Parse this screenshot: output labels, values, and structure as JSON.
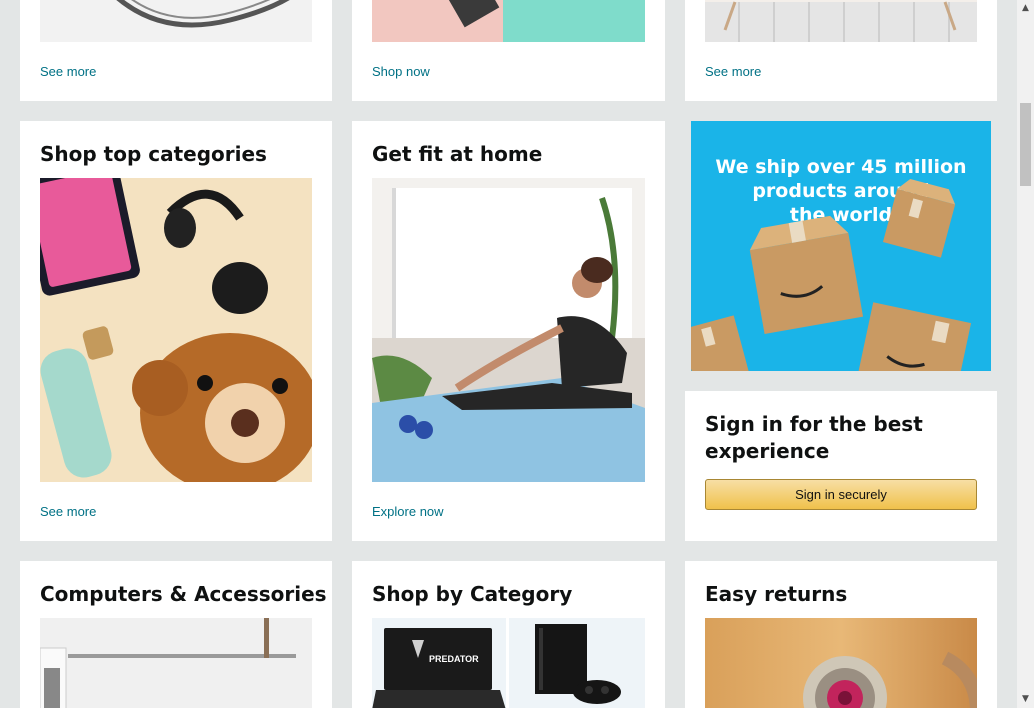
{
  "row1": {
    "col1_link": "See more",
    "col2_link": "Shop now",
    "col3_link": "See more"
  },
  "row2": {
    "col1": {
      "title": "Shop top categories",
      "link": "See more"
    },
    "col2": {
      "title": "Get fit at home",
      "link": "Explore now"
    },
    "promo": {
      "lines": [
        "We ship over 45 million",
        "products around",
        "the world"
      ]
    },
    "signin": {
      "title_line1": "Sign in for the best",
      "title_line2": "experience",
      "button": "Sign in securely"
    }
  },
  "row3": {
    "col1": {
      "title": "Computers & Accessories"
    },
    "col2": {
      "title": "Shop by Category",
      "laptop_brand": "PREDATOR"
    },
    "col3": {
      "title": "Easy returns"
    }
  },
  "scrollbar": {
    "up_icon": "▲",
    "down_icon": "▼"
  },
  "colors": {
    "link": "#007185",
    "background": "#e3e6e6",
    "promo_bg": "#1ab4e8",
    "button": "#f0c14b"
  }
}
